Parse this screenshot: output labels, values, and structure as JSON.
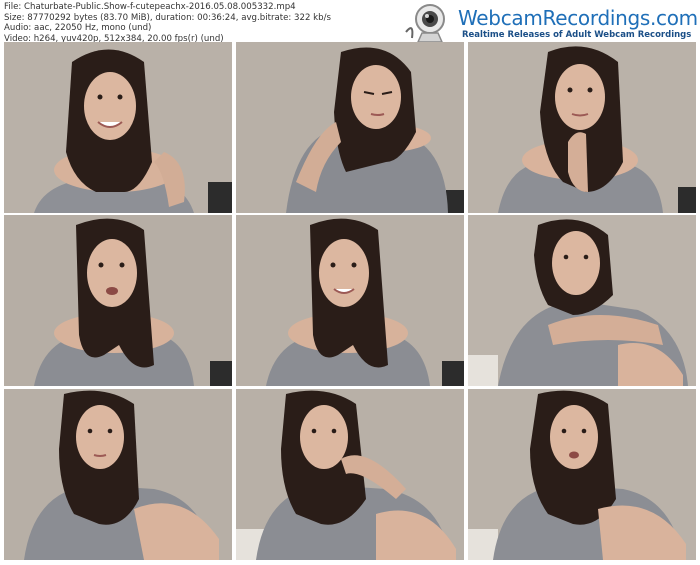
{
  "header": {
    "file_line": "File: Chaturbate-Public.Show-f-cutepeachx-2016.05.08.005332.mp4",
    "size_line": "Size: 87770292 bytes (83.70 MiB), duration: 00:36:24, avg.bitrate: 322 kb/s",
    "audio_line": "Audio: aac, 22050 Hz, mono (und)",
    "video_line": "Video: h264, yuv420p, 512x384, 20.00 fps(r) (und)"
  },
  "logo": {
    "title": "WebcamRecordings.com",
    "subtitle": "Realtime Releases of Adult Webcam Recordings",
    "icon": "webcam-icon",
    "colors": {
      "title": "#1f6fb8",
      "subtitle": "#1b4f87"
    }
  },
  "thumbnails": [
    {
      "pose": "smiling, hand on shoulder"
    },
    {
      "pose": "head tilted, eyes down"
    },
    {
      "pose": "hand at chin"
    },
    {
      "pose": "talking"
    },
    {
      "pose": "smiling"
    },
    {
      "pose": "arms crossed on knee"
    },
    {
      "pose": "neutral"
    },
    {
      "pose": "hand near mouth"
    },
    {
      "pose": "talking, knee raised"
    }
  ],
  "colors": {
    "wall": "#b7afa6",
    "sweater": "#8b8d93",
    "hair": "#2a1d18",
    "skin": "#d9b39c"
  }
}
